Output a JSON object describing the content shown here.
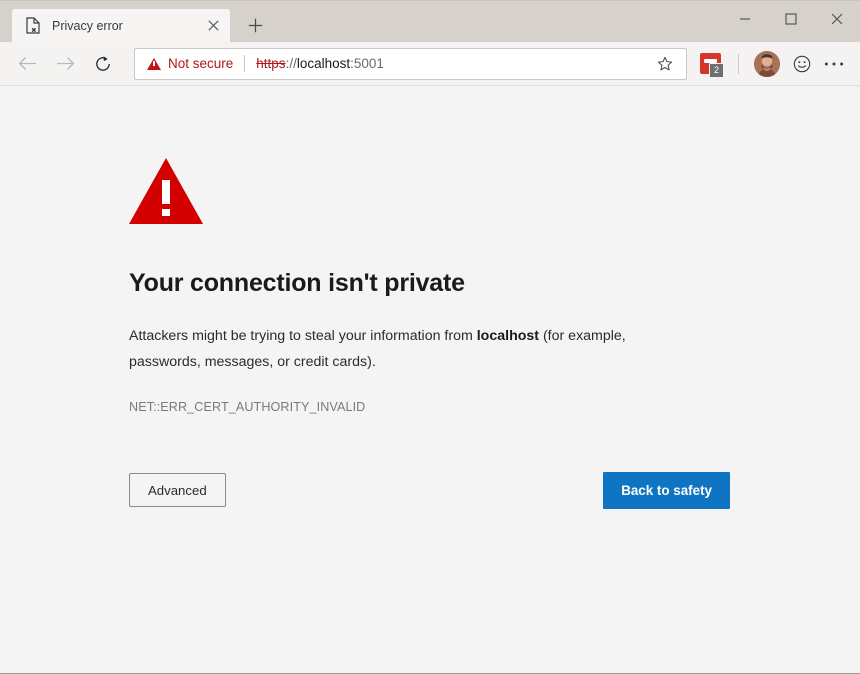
{
  "window": {
    "controls": {
      "minimize": "minimize-icon",
      "maximize": "maximize-icon",
      "close": "close-icon"
    }
  },
  "tabs": {
    "active_index": 0,
    "items": [
      {
        "title": "Privacy error",
        "favicon": "broken-page-icon",
        "close_label": "close-tab-icon"
      }
    ],
    "new_tab_label": "new-tab-icon"
  },
  "toolbar": {
    "back_icon": "back-arrow-icon",
    "forward_icon": "forward-arrow-icon",
    "refresh_icon": "refresh-icon",
    "security": {
      "icon": "warning-triangle-icon",
      "label": "Not secure",
      "color": "#b01818"
    },
    "url": {
      "scheme": "https",
      "separator": "://",
      "host": "localhost",
      "port": ":5001",
      "full": "https://localhost:5001"
    },
    "favorite_icon": "star-icon",
    "extension": {
      "icon": "collections-extension-icon",
      "badge_count": "2",
      "color": "#d6352b"
    },
    "profile_icon": "avatar",
    "feedback_icon": "smiley-face-icon",
    "settings_icon": "more-horizontal-icon"
  },
  "interstitial": {
    "warning_icon": "warning-triangle-icon",
    "warning_color": "#d40000",
    "headline": "Your connection isn't private",
    "body_prefix": "Attackers might be trying to steal your information from ",
    "body_host": "localhost",
    "body_suffix": " (for example, passwords, messages, or credit cards).",
    "error_code": "NET::ERR_CERT_AUTHORITY_INVALID",
    "advanced_button": "Advanced",
    "safety_button": "Back to safety",
    "safety_button_color": "#0f75c3"
  }
}
